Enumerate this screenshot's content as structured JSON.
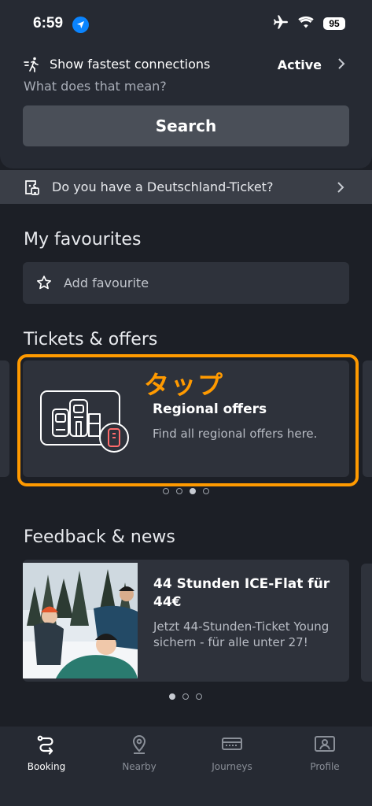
{
  "status_bar": {
    "time": "6:59",
    "battery": "95"
  },
  "search_panel": {
    "fastest_label": "Show fastest connections",
    "fastest_status": "Active",
    "what_mean_link": "What does that mean?",
    "search_button": "Search"
  },
  "deutschland_ticket": {
    "label": "Do you have a Deutschland-Ticket?"
  },
  "favourites": {
    "title": "My favourites",
    "add_label": "Add favourite"
  },
  "tickets": {
    "title": "Tickets & offers",
    "annotation": "タップ",
    "card": {
      "title": "Regional offers",
      "description": "Find all regional offers here."
    },
    "pager": {
      "count": 4,
      "active_index": 2
    }
  },
  "news": {
    "title": "Feedback & news",
    "card": {
      "title": "44 Stunden ICE-Flat für 44€",
      "description": "Jetzt 44-Stunden-Ticket Young sichern - für alle unter 27!"
    },
    "pager": {
      "count": 3,
      "active_index": 0
    }
  },
  "tab_bar": {
    "items": [
      {
        "label": "Booking",
        "icon": "booking-icon",
        "active": true
      },
      {
        "label": "Nearby",
        "icon": "location-pin-icon",
        "active": false
      },
      {
        "label": "Journeys",
        "icon": "ticket-icon",
        "active": false
      },
      {
        "label": "Profile",
        "icon": "profile-card-icon",
        "active": false
      }
    ]
  },
  "colors": {
    "background": "#1c1f26",
    "panel": "#262a33",
    "card": "#2e323b",
    "annotation": "#ff9a00",
    "location_badge": "#0a84ff"
  }
}
